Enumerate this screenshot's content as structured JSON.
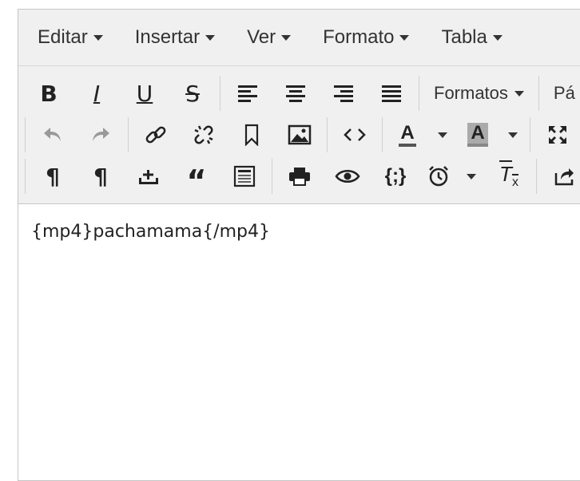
{
  "menubar": {
    "items": [
      "Editar",
      "Insertar",
      "Ver",
      "Formato",
      "Tabla"
    ]
  },
  "toolbar": {
    "bold_label": "B",
    "italic_label": "I",
    "underline_label": "U",
    "strikethrough_label": "S",
    "formats_label": "Formatos",
    "paragraph_label": "Pá",
    "font_color_label": "A",
    "background_color_label": "A",
    "font_color": "#555555",
    "background_color": "#aaaaaa",
    "icons_row1": [
      "bold-icon",
      "italic-icon",
      "underline-icon",
      "strikethrough-icon",
      "align-left-icon",
      "align-center-icon",
      "align-right-icon",
      "align-justify-icon"
    ],
    "icons_row2": [
      "undo-icon",
      "redo-icon",
      "link-icon",
      "unlink-icon",
      "bookmark-icon",
      "image-icon",
      "code-icon",
      "font-color-icon",
      "background-color-icon",
      "fullscreen-icon"
    ],
    "icons_row3": [
      "paragraph-ltr-icon",
      "paragraph-rtl-icon",
      "insert-icon",
      "blockquote-icon",
      "template-icon",
      "print-icon",
      "preview-icon",
      "code-sample-icon",
      "time-icon",
      "remove-format-icon",
      "export-icon"
    ]
  },
  "content": {
    "text": "{mp4}pachamama{/mp4}"
  }
}
